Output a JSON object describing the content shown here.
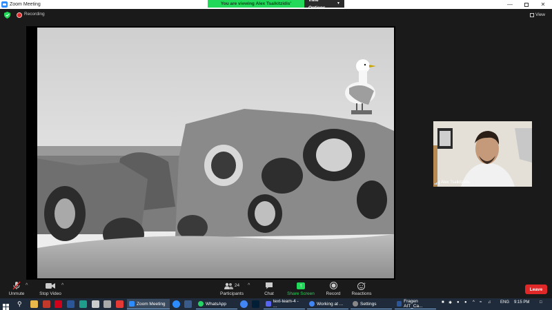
{
  "window": {
    "title": "Zoom Meeting",
    "banner_text": "You are viewing Alex Tsalkitzidis' screen",
    "view_options_label": "View Options"
  },
  "top": {
    "recording_label": "Recording",
    "view_label": "View"
  },
  "participant": {
    "name": "Alex Tsalkitzidis"
  },
  "toolbar": {
    "unmute": "Unmute",
    "stop_video": "Stop Video",
    "participants": "Participants",
    "participants_count": "24",
    "chat": "Chat",
    "share_screen": "Share Screen",
    "record": "Record",
    "reactions": "Reactions",
    "leave": "Leave"
  },
  "taskbar": {
    "apps": {
      "zoom": "Zoom Meeting",
      "whatsapp": "WhatsApp",
      "text_team": "text-team-4 - ...",
      "working": "Working at ...",
      "settings": "Settings",
      "fragen": "Fragen AIT_Ca..."
    },
    "lang": "ENG",
    "time": "9:15 PM"
  },
  "colors": {
    "accent_green": "#23d959",
    "leave_red": "#e02828",
    "zoom_blue": "#2d8cff",
    "taskbar": "#1f2b3a"
  }
}
